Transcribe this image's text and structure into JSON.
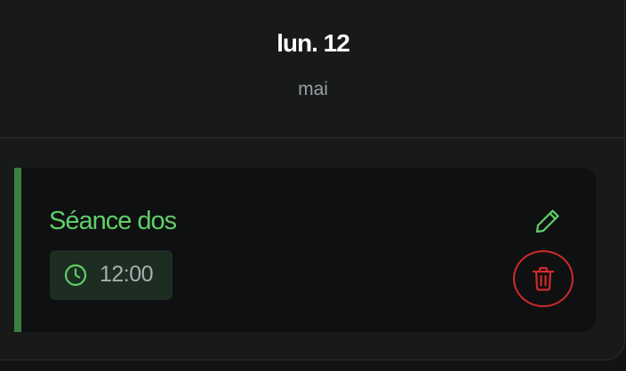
{
  "day": {
    "title": "lun. 12",
    "month": "mai"
  },
  "event": {
    "title": "Séance dos",
    "time": "12:00",
    "accent_color": "#3d8041",
    "title_color": "#5fcf68",
    "icons": {
      "time": "clock-icon",
      "edit": "pencil-icon",
      "delete": "trash-icon"
    },
    "delete_color": "#d12a2a"
  }
}
